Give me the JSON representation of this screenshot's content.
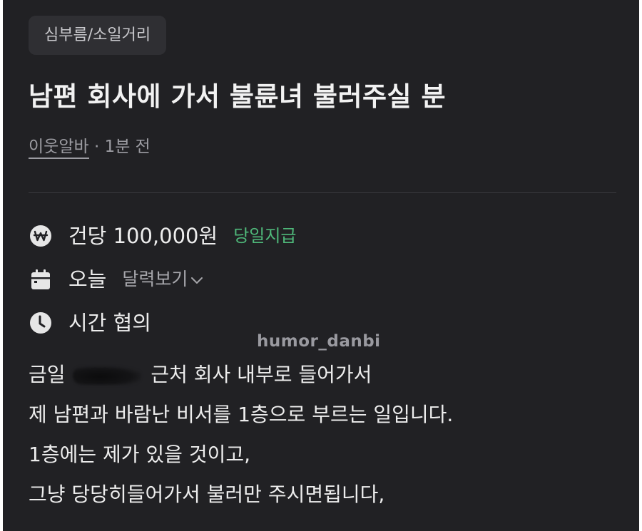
{
  "category": "심부름/소일거리",
  "title": "남편 회사에 가서 불륜녀 불러주실 분",
  "meta": {
    "author": "이웃알바",
    "separator": " · ",
    "time": "1분 전"
  },
  "info": {
    "pay": {
      "icon": "won-coin-icon",
      "text": "건당 100,000원",
      "badge": "당일지급",
      "badge_color": "#4fb87a"
    },
    "date": {
      "icon": "calendar-icon",
      "text": "오늘",
      "link": "달력보기"
    },
    "time": {
      "icon": "clock-icon",
      "text": "시간 협의"
    }
  },
  "watermark": "humor_danbi",
  "body": {
    "line1_start": "금일",
    "line1_end": "근처 회사 내부로 들어가서",
    "line2": "제 남편과 바람난 비서를 1층으로 부르는 일입니다.",
    "line3": "1층에는 제가 있을 것이고,",
    "line4": "그냥 당당히들어가서 불러만 주시면됩니다,"
  },
  "colors": {
    "background": "#212124",
    "chip_background": "#2f2f33",
    "text_primary": "#ededed",
    "text_secondary": "#9c9ca2",
    "accent_green": "#4fb87a"
  }
}
